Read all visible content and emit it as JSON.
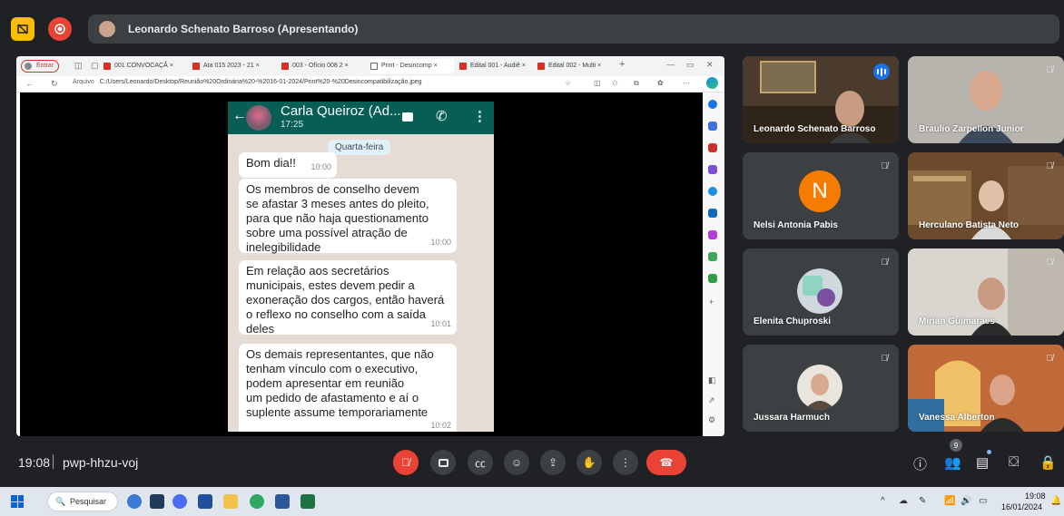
{
  "topbar": {
    "presenter_label": "Leonardo Schenato Barroso (Apresentando)",
    "stop_share_icon": "stop-presenting-icon",
    "record_icon": "record-icon"
  },
  "browser": {
    "profile_label": "Entrar",
    "tabs": [
      {
        "label": "001 CONVOCAÇÃ"
      },
      {
        "label": "Ata 015 2023 - 21"
      },
      {
        "label": "003 - Ofício 008 2"
      },
      {
        "label": "Print - Desincomp"
      },
      {
        "label": "Edital 001 - Audiê"
      },
      {
        "label": "Edital 002 - Multi"
      }
    ],
    "address_prefix": "Arquivo",
    "url": "C:/Users/Leonardo/Desktop/Reunião%20Ordinária%20-%2016-01-2024/Print%20-%20Desincompatibilização.jpeg"
  },
  "whatsapp": {
    "contact_name": "Carla Queiroz (Ad...",
    "contact_time": "17:25",
    "date_chip": "Quarta-feira",
    "messages": [
      {
        "text": "Bom dia!!",
        "time": "10:00"
      },
      {
        "text": "Os membros de conselho devem\nse afastar 3 meses antes do pleito,\npara que não haja questionamento\nsobre uma possível atração de\ninelegibilidade",
        "time": "10:00"
      },
      {
        "text": "Em relação aos secretários\nmunicipais, estes devem pedir a\nexoneração dos cargos, então haverá\no reflexo no conselho com a saída\ndeles",
        "time": "10:01"
      },
      {
        "text": "Os demais representantes, que não\ntenham vínculo com o executivo,\npodem apresentar em reunião\num pedido de afastamento e aí o\nsuplente assume temporariamente",
        "time": "10:02"
      }
    ]
  },
  "participants": [
    {
      "name": "Leonardo Schenato Barroso",
      "muted": false,
      "speaking": true
    },
    {
      "name": "Braulio Zarpellon Junior",
      "muted": true
    },
    {
      "name": "Nelsi Antonia Pabis",
      "initial": "N",
      "avatar_color": "#f57c00",
      "muted": true
    },
    {
      "name": "Herculano Batista Neto",
      "muted": true
    },
    {
      "name": "Elenita Chuproski",
      "muted": true
    },
    {
      "name": "Mirian Guimaraes",
      "muted": true
    },
    {
      "name": "Jussara Harmuch",
      "muted": true
    },
    {
      "name": "Vanessa Alberton",
      "muted": true
    }
  ],
  "meetbar": {
    "time": "19:08",
    "meeting_code": "pwp-hhzu-voj",
    "people_count": "9"
  },
  "taskbar": {
    "search_label": "Pesquisar",
    "clock_time": "19:08",
    "clock_date": "16/01/2024"
  },
  "colors": {
    "meet_bg": "#202124",
    "tile_bg": "#3c4043",
    "end_call": "#ea4335",
    "whatsapp_header": "#075e54",
    "accent": "#1a73e8"
  }
}
